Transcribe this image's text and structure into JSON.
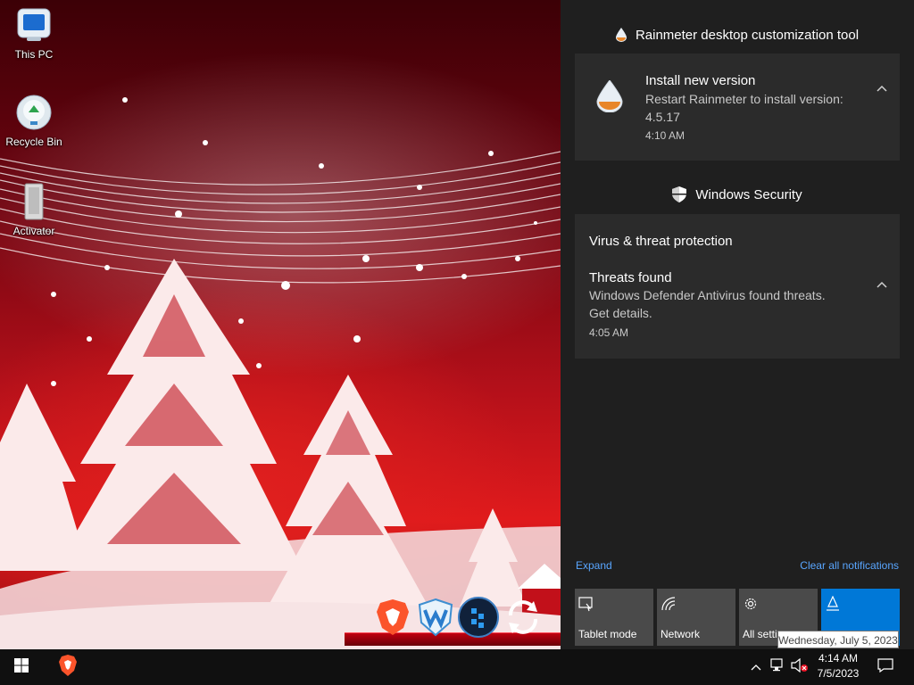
{
  "desktop": {
    "icons": [
      {
        "label": "This PC",
        "icon": "this-pc-icon"
      },
      {
        "label": "Recycle Bin",
        "icon": "recycle-bin-icon"
      },
      {
        "label": "Activator",
        "icon": "activator-icon"
      }
    ],
    "dock": [
      "brave-browser-icon",
      "wise-care-icon",
      "bitdefender-icon",
      "refresh-icon"
    ]
  },
  "action_center": {
    "groups": [
      {
        "app": "Rainmeter desktop customization tool",
        "app_icon": "rainmeter-icon",
        "notification": {
          "title": "Install new version",
          "body_line1": "Restart Rainmeter to install version:",
          "body_line2": "4.5.17",
          "time": "4:10 AM"
        }
      },
      {
        "app": "Windows Security",
        "app_icon": "shield-icon",
        "notification": {
          "heading": "Virus & threat protection",
          "title": "Threats found",
          "body_line1": "Windows Defender Antivirus found threats.",
          "body_line2": "Get details.",
          "time": "4:05 AM"
        }
      }
    ],
    "expand_label": "Expand",
    "clear_label": "Clear all notifications",
    "quick_actions": [
      {
        "label": "Tablet mode",
        "icon": "tablet-mode-icon",
        "active": false
      },
      {
        "label": "Network",
        "icon": "network-icon",
        "active": false
      },
      {
        "label": "All setti",
        "icon": "settings-gear-icon",
        "active": false
      },
      {
        "label": "",
        "icon": "location-icon",
        "active": true
      }
    ],
    "accent_color": "#0078d7"
  },
  "tooltip": {
    "text": "Wednesday, July 5, 2023"
  },
  "taskbar": {
    "time": "4:14 AM",
    "date": "7/5/2023",
    "pinned": [
      "start-windows-icon",
      "brave-browser-icon"
    ],
    "tray": [
      "chevron-up-icon",
      "network-icon",
      "volume-muted-icon",
      "action-center-icon"
    ]
  }
}
